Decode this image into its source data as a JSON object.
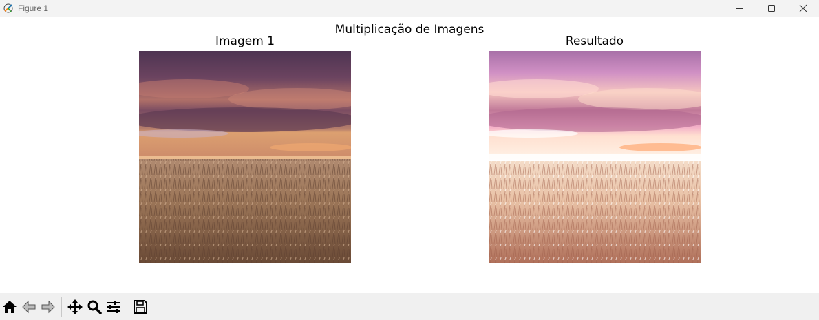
{
  "window": {
    "title": "Figure 1",
    "icon": "matplotlib-icon",
    "controls": [
      "minimize-icon",
      "maximize-icon",
      "close-icon"
    ]
  },
  "figure": {
    "suptitle": "Multiplicação de Imagens",
    "axes": [
      {
        "title": "Imagem 1",
        "content": "wheat field under purple sunset sky"
      },
      {
        "title": "Resultado",
        "content": "brightened wheat field under pink sky"
      }
    ]
  },
  "toolbar": {
    "buttons": [
      {
        "name": "home",
        "icon": "home-icon"
      },
      {
        "name": "back",
        "icon": "arrow-left-icon"
      },
      {
        "name": "forward",
        "icon": "arrow-right-icon"
      },
      {
        "name": "pan",
        "icon": "move-icon"
      },
      {
        "name": "zoom",
        "icon": "magnifier-icon"
      },
      {
        "name": "configure",
        "icon": "sliders-icon"
      },
      {
        "name": "save",
        "icon": "floppy-disk-icon"
      }
    ]
  },
  "colors": {
    "titlebar": "#f3f3f3",
    "toolbar": "#f0f0f0",
    "sky_original": "#5a3a5c",
    "sky_result": "#c98fc0",
    "wheat_original": "#9c7658",
    "wheat_result": "#e8c0a4"
  }
}
